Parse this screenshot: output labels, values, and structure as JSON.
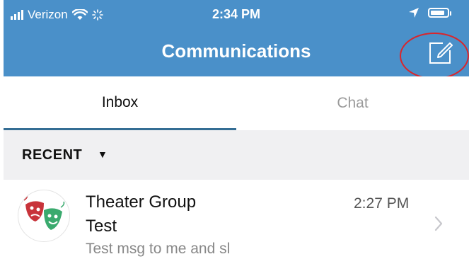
{
  "status_bar": {
    "carrier": "Verizon",
    "time": "2:34 PM",
    "icons": [
      "signal-bars-icon",
      "wifi-icon",
      "loading-spinner-icon",
      "location-arrow-icon",
      "battery-icon"
    ]
  },
  "nav": {
    "title": "Communications",
    "compose_icon": "compose-icon"
  },
  "tabs": [
    {
      "label": "Inbox",
      "active": true
    },
    {
      "label": "Chat",
      "active": false
    }
  ],
  "section": {
    "label": "RECENT",
    "caret": "▼"
  },
  "messages": [
    {
      "title_line1": "Theater Group",
      "title_line2": "Test",
      "time": "2:27 PM",
      "preview": "Test msg to me and sl",
      "avatar_icon": "theater-masks-icon"
    }
  ],
  "colors": {
    "header": "#4a90c9",
    "tab_underline": "#346d94",
    "annotation": "#d9262c",
    "section_bg": "#f0f0f2"
  }
}
